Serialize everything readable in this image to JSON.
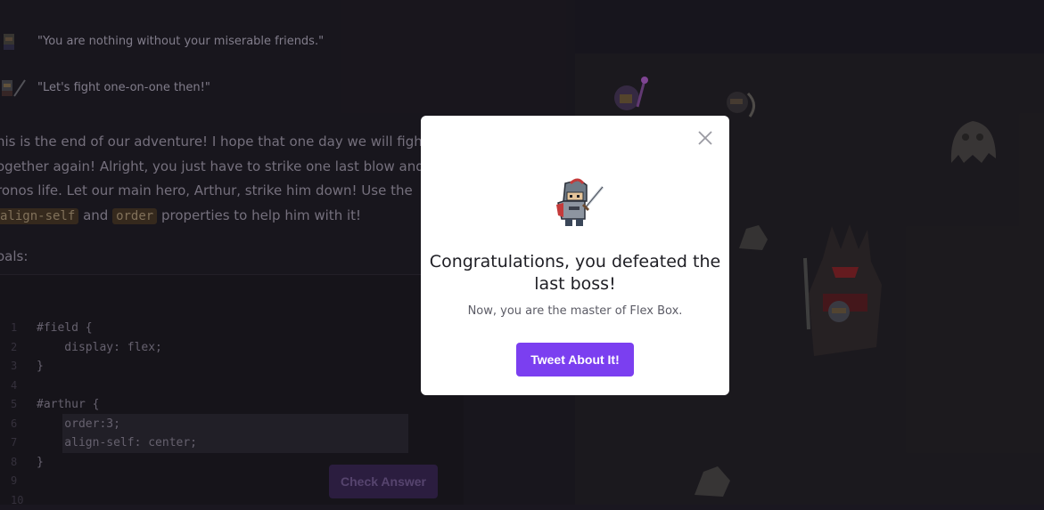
{
  "dialogue": [
    {
      "text": "\"You are nothing without your miserable friends.\""
    },
    {
      "text": "\"Let's fight one-on-one then!\""
    }
  ],
  "story": {
    "line1": "his is the end of our adventure! I hope that one day we will fight",
    "line2": "ogether again! Alright, you just have to strike one last blow and ta",
    "line3": "ronos life. Let our main hero, Arthur, strike him down! Use the",
    "code1": "align-self",
    "and": " and ",
    "code2": "order",
    "tail": " properties to help him with it!"
  },
  "goals_label": "oals:",
  "editor": {
    "lines": [
      {
        "n": "1",
        "text": "#field {"
      },
      {
        "n": "2",
        "text": "    display: flex;"
      },
      {
        "n": "3",
        "text": "}"
      },
      {
        "n": "4",
        "text": ""
      },
      {
        "n": "5",
        "text": "#arthur {"
      },
      {
        "n": "6",
        "text": "    order:3;"
      },
      {
        "n": "7",
        "text": "    align-self: center;"
      },
      {
        "n": "8",
        "text": "}"
      },
      {
        "n": "9",
        "text": ""
      },
      {
        "n": "10",
        "text": ""
      }
    ],
    "check_label": "Check Answer"
  },
  "modal": {
    "title": "Congratulations, you defeated the last boss!",
    "subtitle": "Now, you are the master of Flex Box.",
    "tweet_label": "Tweet About It!",
    "close_icon": "close-icon"
  },
  "colors": {
    "accent": "#7b3ff0",
    "modal_bg": "#ffffff",
    "page_bg": "#1a1720"
  }
}
